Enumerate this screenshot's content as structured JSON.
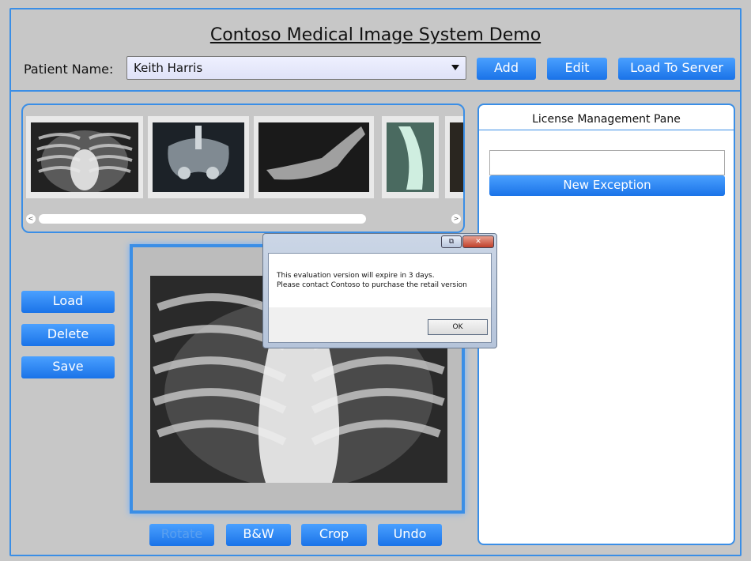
{
  "app": {
    "title": "Contoso Medical Image System Demo"
  },
  "patient": {
    "label": "Patient Name:",
    "selected": "Keith Harris"
  },
  "toolbar": {
    "add": "Add",
    "edit": "Edit",
    "load_to_server": "Load To Server"
  },
  "side_buttons": {
    "load": "Load",
    "delete": "Delete",
    "save": "Save"
  },
  "bottom_buttons": {
    "rotate": "Rotate",
    "bw": "B&W",
    "crop": "Crop",
    "undo": "Undo"
  },
  "license": {
    "title": "License Management Pane",
    "new_exception": "New Exception",
    "input_value": ""
  },
  "dialog": {
    "line1": "This evaluation version will expire in 3 days.",
    "line2": "Please contact Contoso to purchase the retail version",
    "ok": "OK",
    "restore_glyph": "⧉",
    "close_glyph": "✕"
  },
  "scroll": {
    "left_glyph": "<",
    "right_glyph": ">"
  },
  "colors": {
    "accent": "#3a8ee6",
    "button": "#1a73e8",
    "background": "#c7c7c7"
  }
}
